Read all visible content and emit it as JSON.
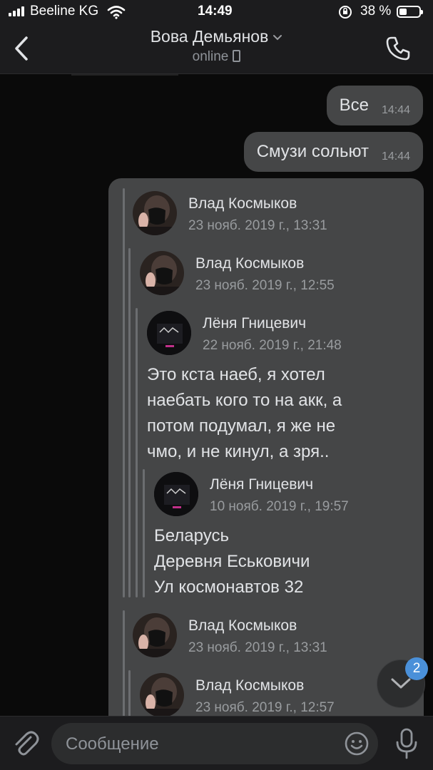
{
  "status_bar": {
    "carrier": "Beeline KG",
    "time": "14:49",
    "battery_percent": "38 %",
    "battery_level": 0.38
  },
  "header": {
    "title": "Вова Демьянов",
    "subtitle": "online",
    "back_icon": "chevron-left-icon",
    "call_icon": "phone-icon"
  },
  "messages_out": [
    {
      "text": "Все",
      "time": "14:44"
    },
    {
      "text": "Смузи сольют",
      "time": "14:44"
    }
  ],
  "forwarded": {
    "level1_a": {
      "name": "Влад Космыков",
      "date": "23 нояб. 2019 г., 13:31"
    },
    "level2_a": {
      "name": "Влад Космыков",
      "date": "23 нояб. 2019 г., 12:55"
    },
    "level3": {
      "name": "Лёня Гницевич",
      "date": "22 нояб. 2019 г., 21:48",
      "lines": [
        "Это кста наеб, я хотел",
        "наебать кого то на акк, а",
        "потом подумал, я же не",
        "чмо, и не кинул, а зря.."
      ]
    },
    "level4": {
      "name": "Лёня Гницевич",
      "date": "10 нояб. 2019 г., 19:57",
      "lines": [
        "Беларусь",
        "Деревня Еськовичи",
        "Ул космонавтов 32"
      ]
    },
    "level1_b": {
      "name": "Влад Космыков",
      "date": "23 нояб. 2019 г., 13:31"
    },
    "level2_b": {
      "name": "Влад Космыков",
      "date": "23 нояб. 2019 г., 12:57"
    }
  },
  "scroll_down": {
    "badge": "2"
  },
  "composer": {
    "placeholder": "Сообщение",
    "attach_icon": "paperclip-icon",
    "emoji_icon": "emoji-icon",
    "mic_icon": "microphone-icon"
  },
  "colors": {
    "background": "#0a0a0a",
    "bar": "#1c1c1e",
    "bubble": "#454647",
    "badge": "#4a90d9"
  }
}
